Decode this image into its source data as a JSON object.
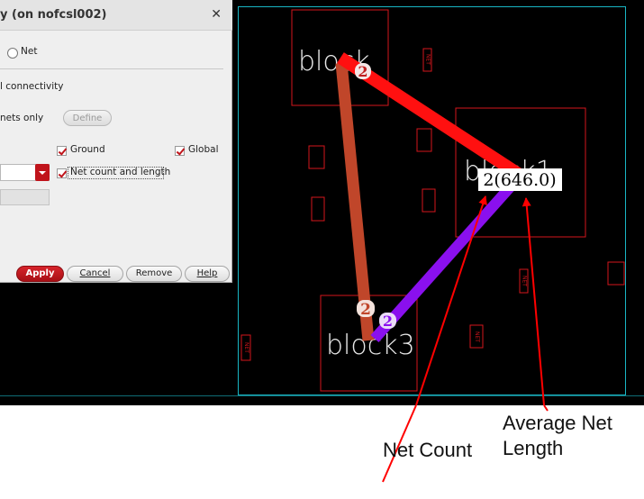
{
  "dialog": {
    "title": "y (on nofcsl002)",
    "net_radio_label": "Net",
    "connectivity_label": "l connectivity",
    "nets_only_label": "nets only",
    "define_label": "Define",
    "ground_label": "Ground",
    "global_label": "Global",
    "net_count_length_label": "Net count and length",
    "buttons": {
      "apply": "Apply",
      "cancel": "Cancel",
      "remove": "Remove",
      "help": "Help"
    }
  },
  "canvas": {
    "blocks": [
      "block",
      "block1",
      "block3"
    ],
    "flight_line_badges": [
      "2",
      "2",
      "2"
    ],
    "net_count_length_label": "2(646.0)",
    "pin_labels": [
      "NET",
      "NET",
      "NET",
      "NET"
    ],
    "colors": {
      "background": "#000000",
      "border": "#19b6c4",
      "shape_outline": "#d4161c",
      "net_red": "#ff1010",
      "net_brown": "#c0462a",
      "net_purple": "#8a10ee"
    }
  },
  "annotations": {
    "net_count": "Net Count",
    "average_net_length_line1": "Average Net",
    "average_net_length_line2": "Length"
  }
}
